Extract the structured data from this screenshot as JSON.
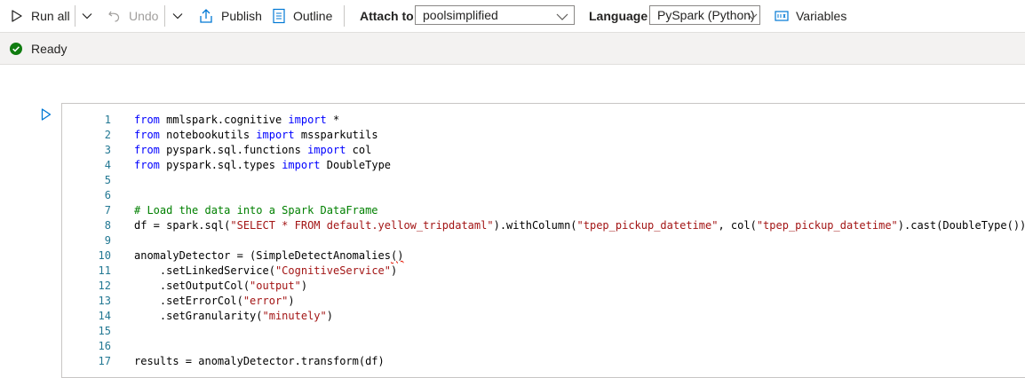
{
  "toolbar": {
    "run_all": "Run all",
    "undo": "Undo",
    "publish": "Publish",
    "outline": "Outline",
    "attach_to_label": "Attach to",
    "attach_to_value": "poolsimplified",
    "language_label": "Language",
    "language_value": "PySpark (Python)",
    "variables": "Variables"
  },
  "status": {
    "text": "Ready",
    "color": "#107c10"
  },
  "colors": {
    "accent": "#0078d4",
    "keyword": "#0000ff",
    "string": "#a31515",
    "comment": "#008000",
    "line_number": "#237893"
  },
  "icons": [
    "play-icon",
    "chevron-down-icon",
    "undo-icon",
    "publish-icon",
    "outline-icon",
    "variables-icon",
    "checkmark-circle-icon",
    "run-cell-icon"
  ],
  "code": {
    "line_numbers": [
      "1",
      "2",
      "3",
      "4",
      "5",
      "6",
      "7",
      "8",
      "9",
      "10",
      "11",
      "12",
      "13",
      "14",
      "15",
      "16",
      "17"
    ],
    "l1": {
      "a": "from",
      "b": " mmlspark.cognitive ",
      "c": "import",
      "d": " *"
    },
    "l2": {
      "a": "from",
      "b": " notebookutils ",
      "c": "import",
      "d": " mssparkutils"
    },
    "l3": {
      "a": "from",
      "b": " pyspark.sql.functions ",
      "c": "import",
      "d": " col"
    },
    "l4": {
      "a": "from",
      "b": " pyspark.sql.types ",
      "c": "import",
      "d": " DoubleType"
    },
    "l7": "# Load the data into a Spark DataFrame",
    "l8": {
      "a": "df = spark.sql(",
      "b": "\"SELECT * FROM default.yellow_tripdataml\"",
      "c": ").withColumn(",
      "d": "\"tpep_pickup_datetime\"",
      "e": ", col(",
      "f": "\"tpep_pickup_datetime\"",
      "g": ").cast(DoubleType()))"
    },
    "l10": {
      "a": "anomalyDetector = (SimpleDetectAnomalies",
      "b": "()"
    },
    "l11": {
      "a": "    .setLinkedService(",
      "b": "\"CognitiveService\"",
      "c": ")"
    },
    "l12": {
      "a": "    .setOutputCol(",
      "b": "\"output\"",
      "c": ")"
    },
    "l13": {
      "a": "    .setErrorCol(",
      "b": "\"error\"",
      "c": ")"
    },
    "l14": {
      "a": "    .setGranularity(",
      "b": "\"minutely\"",
      "c": ")"
    },
    "l17": "results = anomalyDetector.transform(df)"
  }
}
